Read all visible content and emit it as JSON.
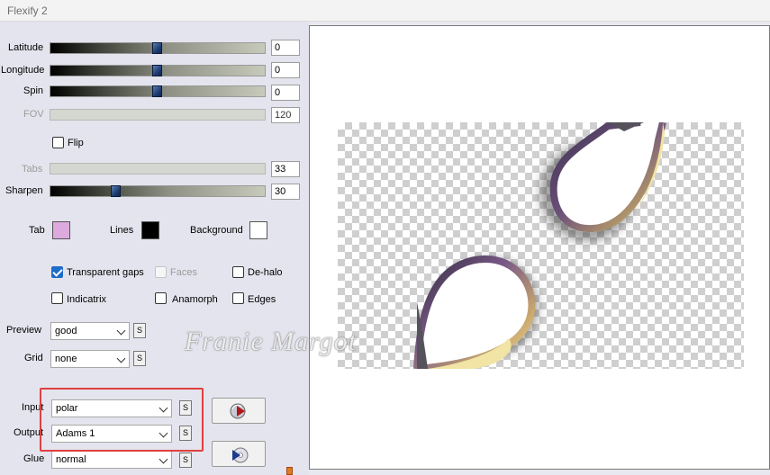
{
  "window": {
    "title": "Flexify 2"
  },
  "sliders": {
    "latitude": {
      "label": "Latitude",
      "value": "0",
      "level": 0.5
    },
    "longitude": {
      "label": "Longitude",
      "value": "0",
      "level": 0.5
    },
    "spin": {
      "label": "Spin",
      "value": "0",
      "level": 0.5
    },
    "fov": {
      "label": "FOV",
      "value": "120"
    },
    "tabs": {
      "label": "Tabs",
      "value": "33"
    },
    "sharpen": {
      "label": "Sharpen",
      "value": "30",
      "level": 0.3
    }
  },
  "flip": {
    "label": "Flip",
    "checked": false
  },
  "colors": {
    "tab": {
      "label": "Tab",
      "color": "#dcaadc"
    },
    "lines": {
      "label": "Lines",
      "color": "#000000"
    },
    "background": {
      "label": "Background",
      "color": "#ffffff"
    }
  },
  "options": {
    "transparent_gaps": {
      "label": "Transparent gaps",
      "checked": true
    },
    "faces": {
      "label": "Faces",
      "checked": false,
      "disabled": true
    },
    "de_halo": {
      "label": "De-halo",
      "checked": false
    },
    "indicatrix": {
      "label": "Indicatrix",
      "checked": false
    },
    "anamorph": {
      "label": "Anamorph",
      "checked": false
    },
    "edges": {
      "label": "Edges",
      "checked": false
    }
  },
  "dropdowns": {
    "preview": {
      "label": "Preview",
      "value": "good"
    },
    "grid": {
      "label": "Grid",
      "value": "none"
    },
    "input": {
      "label": "Input",
      "value": "polar"
    },
    "output": {
      "label": "Output",
      "value": "Adams 1"
    },
    "glue": {
      "label": "Glue",
      "value": "normal"
    }
  },
  "small_button_label": "S",
  "watermark": "Franie Margot",
  "accent": "#1d6cc8",
  "highlight": "#e0403f"
}
